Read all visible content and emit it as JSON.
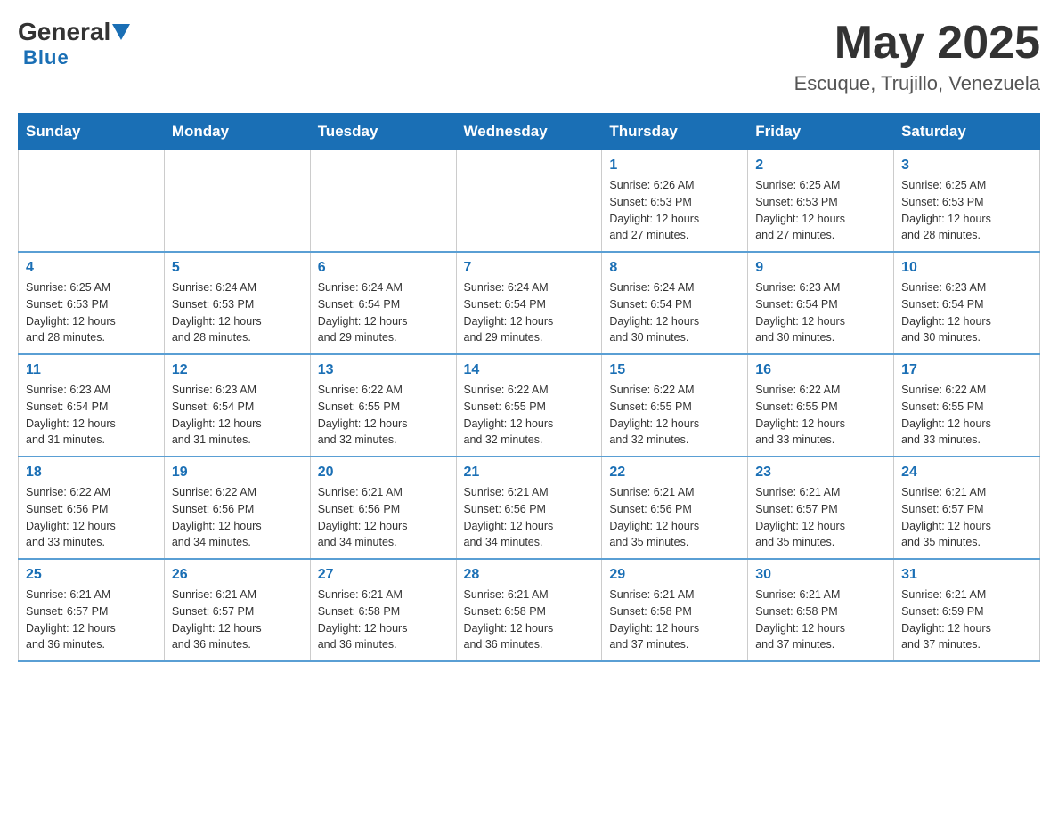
{
  "header": {
    "logo": {
      "general": "General",
      "blue": "Blue"
    },
    "title": "May 2025",
    "location": "Escuque, Trujillo, Venezuela"
  },
  "calendar": {
    "days_of_week": [
      "Sunday",
      "Monday",
      "Tuesday",
      "Wednesday",
      "Thursday",
      "Friday",
      "Saturday"
    ],
    "weeks": [
      [
        {
          "day": "",
          "info": ""
        },
        {
          "day": "",
          "info": ""
        },
        {
          "day": "",
          "info": ""
        },
        {
          "day": "",
          "info": ""
        },
        {
          "day": "1",
          "info": "Sunrise: 6:26 AM\nSunset: 6:53 PM\nDaylight: 12 hours\nand 27 minutes."
        },
        {
          "day": "2",
          "info": "Sunrise: 6:25 AM\nSunset: 6:53 PM\nDaylight: 12 hours\nand 27 minutes."
        },
        {
          "day": "3",
          "info": "Sunrise: 6:25 AM\nSunset: 6:53 PM\nDaylight: 12 hours\nand 28 minutes."
        }
      ],
      [
        {
          "day": "4",
          "info": "Sunrise: 6:25 AM\nSunset: 6:53 PM\nDaylight: 12 hours\nand 28 minutes."
        },
        {
          "day": "5",
          "info": "Sunrise: 6:24 AM\nSunset: 6:53 PM\nDaylight: 12 hours\nand 28 minutes."
        },
        {
          "day": "6",
          "info": "Sunrise: 6:24 AM\nSunset: 6:54 PM\nDaylight: 12 hours\nand 29 minutes."
        },
        {
          "day": "7",
          "info": "Sunrise: 6:24 AM\nSunset: 6:54 PM\nDaylight: 12 hours\nand 29 minutes."
        },
        {
          "day": "8",
          "info": "Sunrise: 6:24 AM\nSunset: 6:54 PM\nDaylight: 12 hours\nand 30 minutes."
        },
        {
          "day": "9",
          "info": "Sunrise: 6:23 AM\nSunset: 6:54 PM\nDaylight: 12 hours\nand 30 minutes."
        },
        {
          "day": "10",
          "info": "Sunrise: 6:23 AM\nSunset: 6:54 PM\nDaylight: 12 hours\nand 30 minutes."
        }
      ],
      [
        {
          "day": "11",
          "info": "Sunrise: 6:23 AM\nSunset: 6:54 PM\nDaylight: 12 hours\nand 31 minutes."
        },
        {
          "day": "12",
          "info": "Sunrise: 6:23 AM\nSunset: 6:54 PM\nDaylight: 12 hours\nand 31 minutes."
        },
        {
          "day": "13",
          "info": "Sunrise: 6:22 AM\nSunset: 6:55 PM\nDaylight: 12 hours\nand 32 minutes."
        },
        {
          "day": "14",
          "info": "Sunrise: 6:22 AM\nSunset: 6:55 PM\nDaylight: 12 hours\nand 32 minutes."
        },
        {
          "day": "15",
          "info": "Sunrise: 6:22 AM\nSunset: 6:55 PM\nDaylight: 12 hours\nand 32 minutes."
        },
        {
          "day": "16",
          "info": "Sunrise: 6:22 AM\nSunset: 6:55 PM\nDaylight: 12 hours\nand 33 minutes."
        },
        {
          "day": "17",
          "info": "Sunrise: 6:22 AM\nSunset: 6:55 PM\nDaylight: 12 hours\nand 33 minutes."
        }
      ],
      [
        {
          "day": "18",
          "info": "Sunrise: 6:22 AM\nSunset: 6:56 PM\nDaylight: 12 hours\nand 33 minutes."
        },
        {
          "day": "19",
          "info": "Sunrise: 6:22 AM\nSunset: 6:56 PM\nDaylight: 12 hours\nand 34 minutes."
        },
        {
          "day": "20",
          "info": "Sunrise: 6:21 AM\nSunset: 6:56 PM\nDaylight: 12 hours\nand 34 minutes."
        },
        {
          "day": "21",
          "info": "Sunrise: 6:21 AM\nSunset: 6:56 PM\nDaylight: 12 hours\nand 34 minutes."
        },
        {
          "day": "22",
          "info": "Sunrise: 6:21 AM\nSunset: 6:56 PM\nDaylight: 12 hours\nand 35 minutes."
        },
        {
          "day": "23",
          "info": "Sunrise: 6:21 AM\nSunset: 6:57 PM\nDaylight: 12 hours\nand 35 minutes."
        },
        {
          "day": "24",
          "info": "Sunrise: 6:21 AM\nSunset: 6:57 PM\nDaylight: 12 hours\nand 35 minutes."
        }
      ],
      [
        {
          "day": "25",
          "info": "Sunrise: 6:21 AM\nSunset: 6:57 PM\nDaylight: 12 hours\nand 36 minutes."
        },
        {
          "day": "26",
          "info": "Sunrise: 6:21 AM\nSunset: 6:57 PM\nDaylight: 12 hours\nand 36 minutes."
        },
        {
          "day": "27",
          "info": "Sunrise: 6:21 AM\nSunset: 6:58 PM\nDaylight: 12 hours\nand 36 minutes."
        },
        {
          "day": "28",
          "info": "Sunrise: 6:21 AM\nSunset: 6:58 PM\nDaylight: 12 hours\nand 36 minutes."
        },
        {
          "day": "29",
          "info": "Sunrise: 6:21 AM\nSunset: 6:58 PM\nDaylight: 12 hours\nand 37 minutes."
        },
        {
          "day": "30",
          "info": "Sunrise: 6:21 AM\nSunset: 6:58 PM\nDaylight: 12 hours\nand 37 minutes."
        },
        {
          "day": "31",
          "info": "Sunrise: 6:21 AM\nSunset: 6:59 PM\nDaylight: 12 hours\nand 37 minutes."
        }
      ]
    ]
  }
}
